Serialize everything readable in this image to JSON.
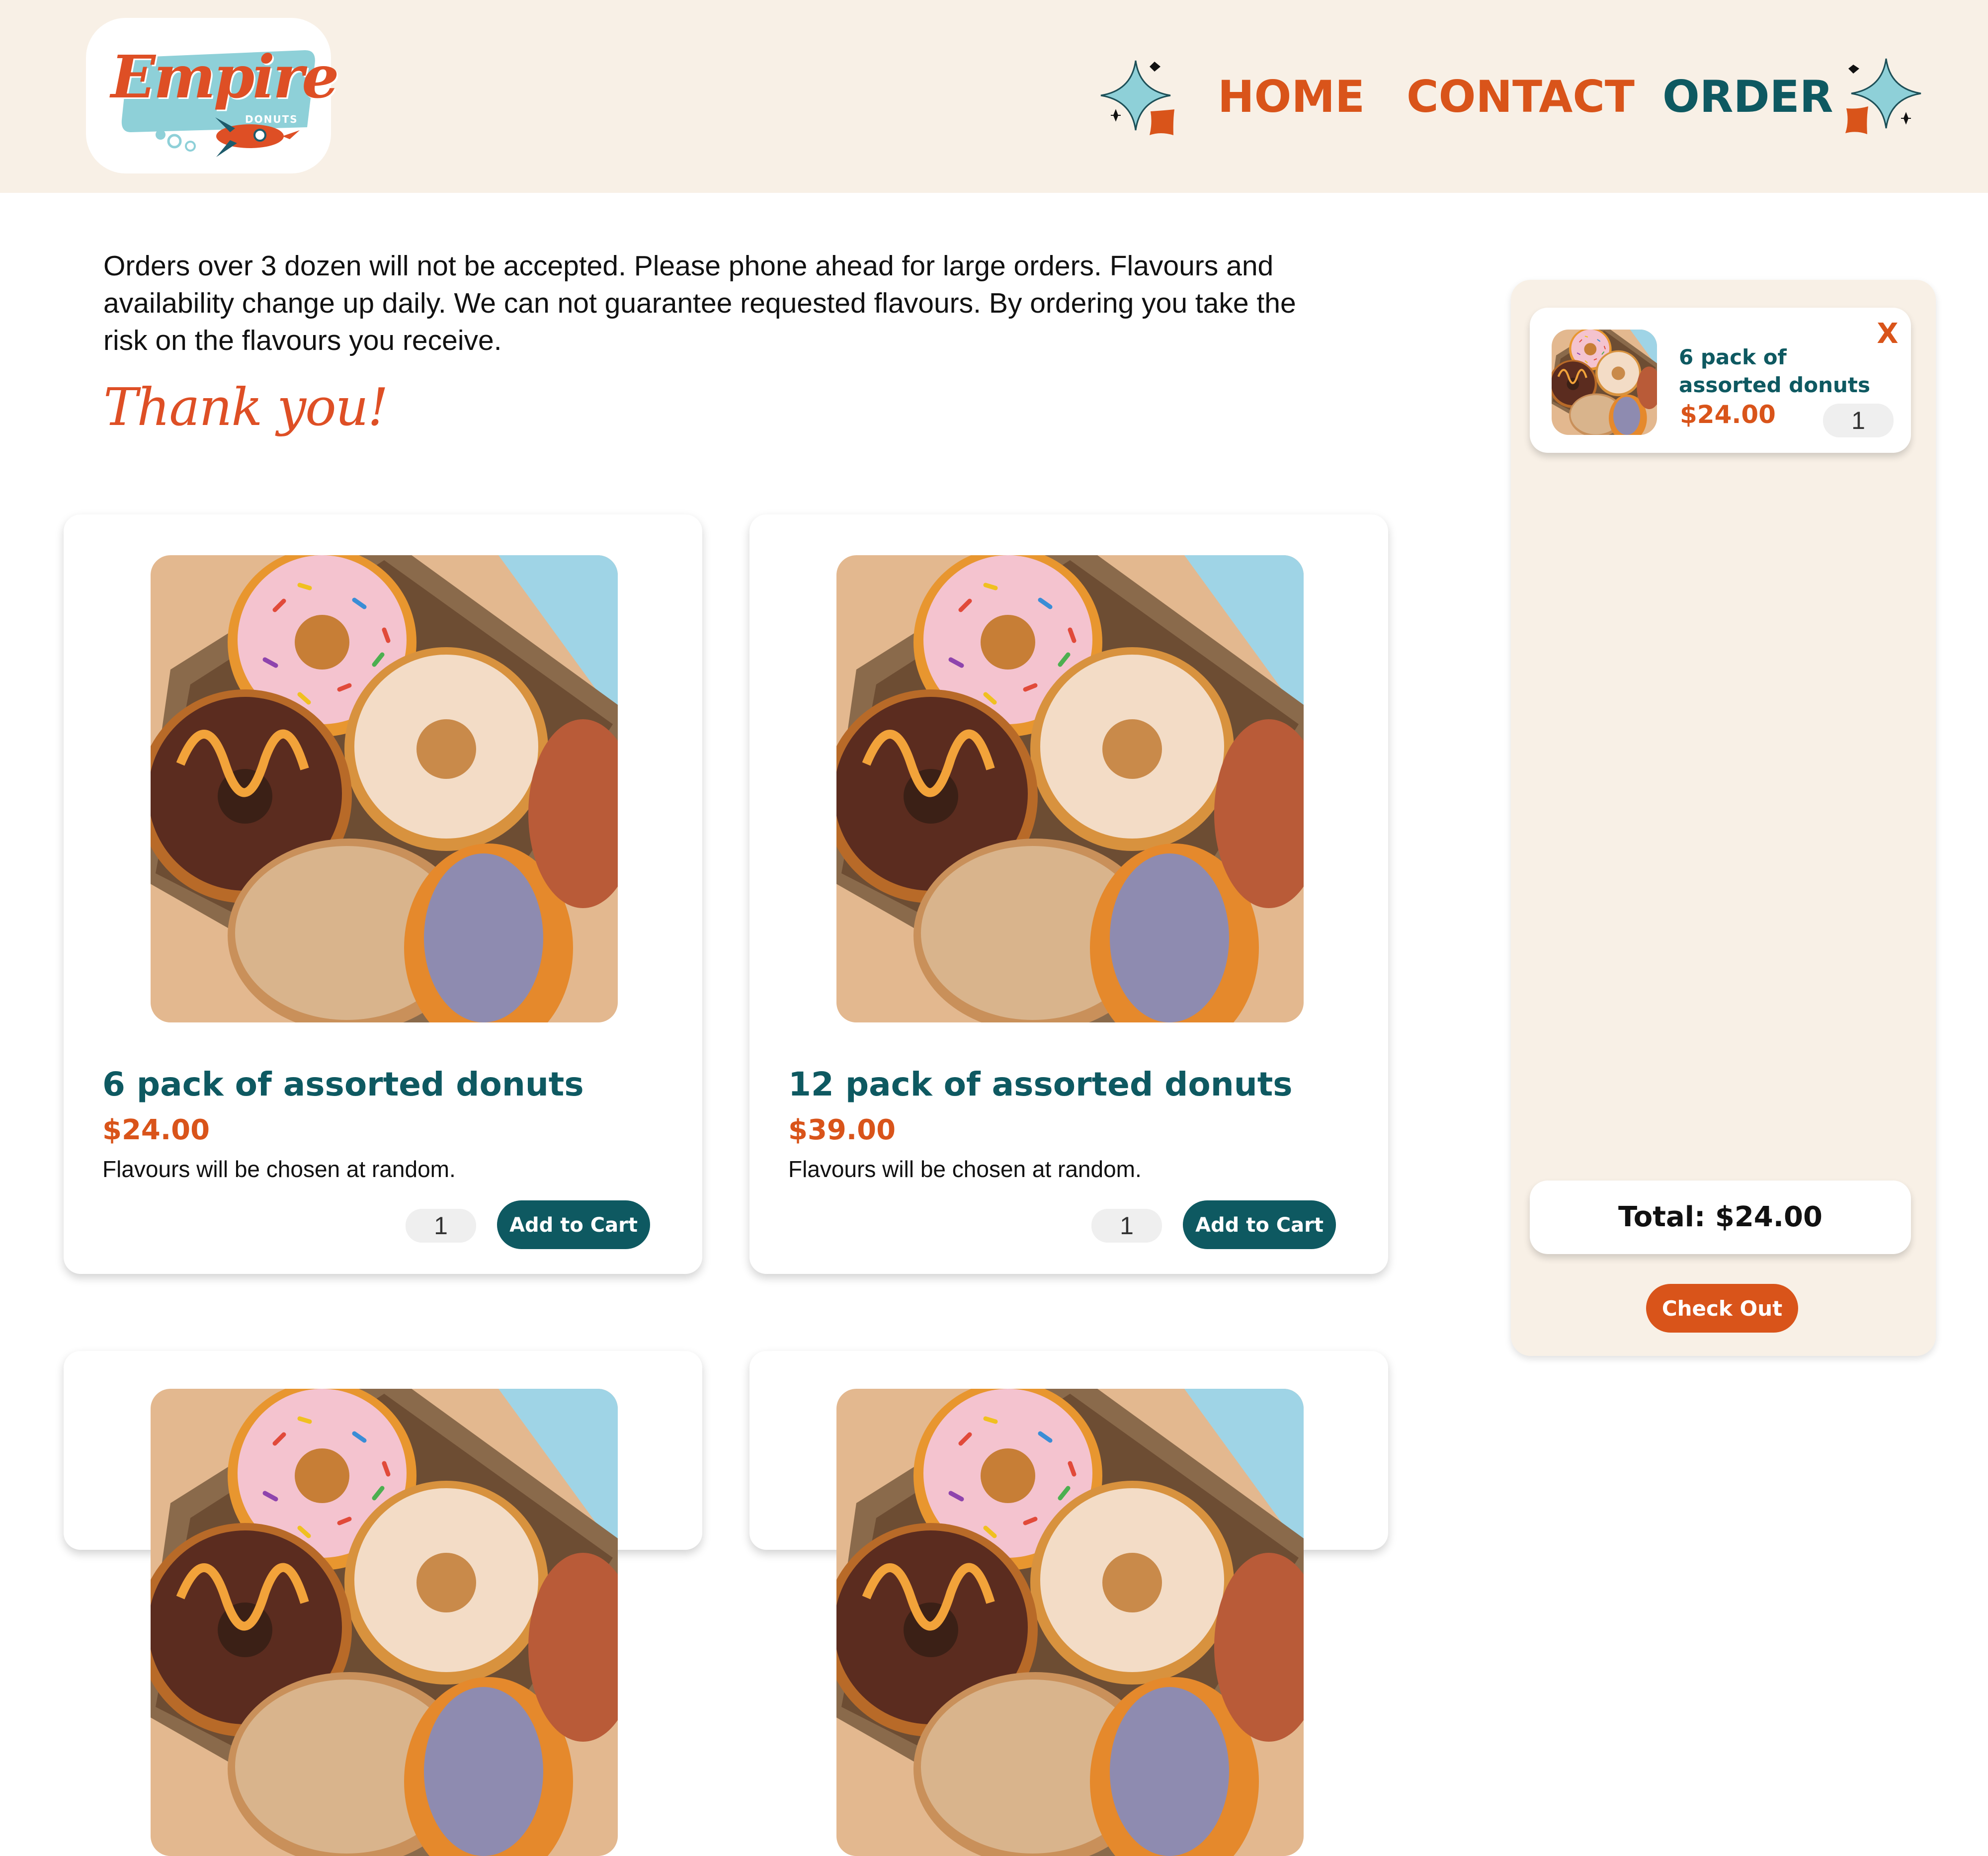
{
  "brand": {
    "logo_word": "Empire",
    "logo_sub": "DONUTS"
  },
  "nav": {
    "items": [
      {
        "label": "HOME",
        "active": false
      },
      {
        "label": "CONTACT",
        "active": false
      },
      {
        "label": "ORDER",
        "active": true
      }
    ]
  },
  "intro": {
    "notice": "Orders over 3 dozen will not be accepted. Please phone ahead for large  orders. Flavours and availability change up daily. We can not guarantee  requested flavours. By ordering you take the risk on the flavours you  receive.",
    "thanks": "Thank you!"
  },
  "products": [
    {
      "title": "6 pack of assorted donuts",
      "price": "$24.00",
      "description": "Flavours will be chosen at random.",
      "quantity": "1",
      "button": "Add to Cart"
    },
    {
      "title": "12 pack of assorted donuts",
      "price": "$39.00",
      "description": "Flavours will be chosen at random.",
      "quantity": "1",
      "button": "Add to Cart"
    }
  ],
  "cart": {
    "items": [
      {
        "name": "6 pack of assorted donuts",
        "price": "$24.00",
        "quantity": "1",
        "remove": "X"
      }
    ],
    "total": "Total: $24.00",
    "checkout": "Check Out"
  },
  "colors": {
    "header_bg": "#f8f0e6",
    "brand_orange": "#d9541a",
    "brand_teal": "#0e5961",
    "sparkle_blue": "#8ed0d8"
  },
  "icons": [
    "sparkle-icon",
    "rocket-icon",
    "close-icon"
  ]
}
